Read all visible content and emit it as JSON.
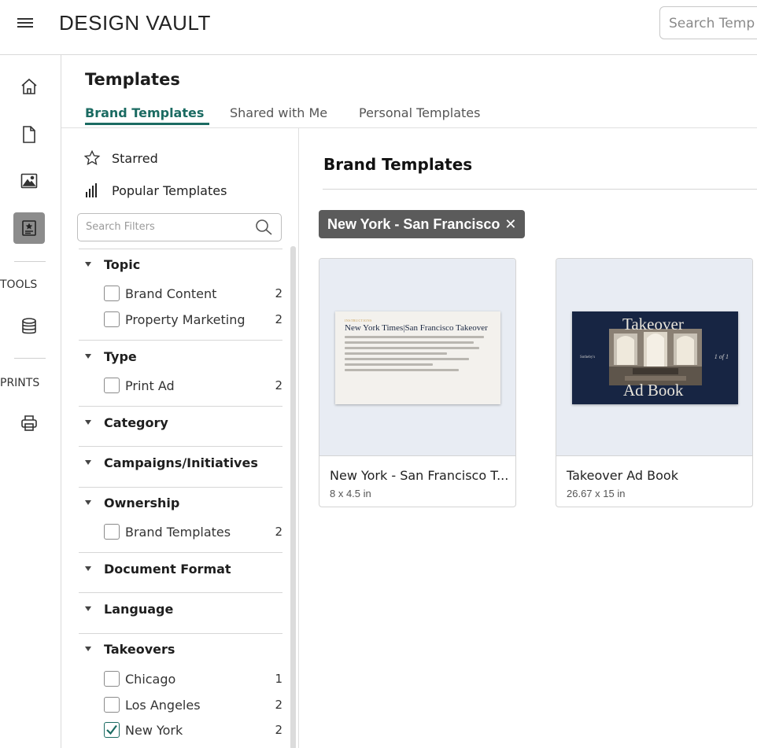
{
  "header": {
    "app_title": "DESIGN VAULT",
    "search_placeholder": "Search Temp"
  },
  "rail": {
    "tools_label": "TOOLS",
    "prints_label": "PRINTS",
    "icons": [
      "home-icon",
      "document-icon",
      "image-icon",
      "templates-icon",
      "database-icon",
      "printer-icon"
    ],
    "active_icon": "templates-icon"
  },
  "page": {
    "title": "Templates",
    "tabs": [
      {
        "label": "Brand Templates",
        "active": true
      },
      {
        "label": "Shared with Me",
        "active": false
      },
      {
        "label": "Personal Templates",
        "active": false
      }
    ]
  },
  "filters": {
    "quick": [
      {
        "label": "Starred",
        "icon": "star-icon"
      },
      {
        "label": "Popular Templates",
        "icon": "bar-chart-icon"
      }
    ],
    "search_placeholder": "Search Filters",
    "sections": {
      "topic": {
        "title": "Topic",
        "options": [
          {
            "label": "Brand Content",
            "count": "2",
            "checked": false
          },
          {
            "label": "Property Marketing",
            "count": "2",
            "checked": false
          }
        ]
      },
      "type": {
        "title": "Type",
        "options": [
          {
            "label": "Print Ad",
            "count": "2",
            "checked": false
          }
        ]
      },
      "category": {
        "title": "Category"
      },
      "campaigns": {
        "title": "Campaigns/Initiatives"
      },
      "ownership": {
        "title": "Ownership",
        "options": [
          {
            "label": "Brand Templates",
            "count": "2",
            "checked": false
          }
        ]
      },
      "document_format": {
        "title": "Document Format"
      },
      "language": {
        "title": "Language"
      },
      "takeovers": {
        "title": "Takeovers",
        "options": [
          {
            "label": "Chicago",
            "count": "1",
            "checked": false
          },
          {
            "label": "Los Angeles",
            "count": "2",
            "checked": false
          },
          {
            "label": "New York",
            "count": "2",
            "checked": true
          }
        ]
      }
    }
  },
  "main": {
    "title": "Brand Templates",
    "active_filter_chip": "New York - San Francisco",
    "cards": [
      {
        "name": "New York - San Francisco T...",
        "size": "8 x 4.5 in",
        "thumb_kicker": "INSTRUCTIONS",
        "thumb_heading": "New York Times|San Francisco Takeover"
      },
      {
        "name": "Takeover Ad Book",
        "size": "26.67 x 15 in",
        "thumb_line1": "Takeover",
        "thumb_line2": "Ad Book",
        "thumb_brand": "Sotheby's",
        "thumb_page": "1 of 1"
      }
    ]
  },
  "colors": {
    "accent": "#1b6b62",
    "chip_bg": "#5b5b5b",
    "thumb_bg": "#e8ecf3",
    "ad_navy": "#172543"
  }
}
